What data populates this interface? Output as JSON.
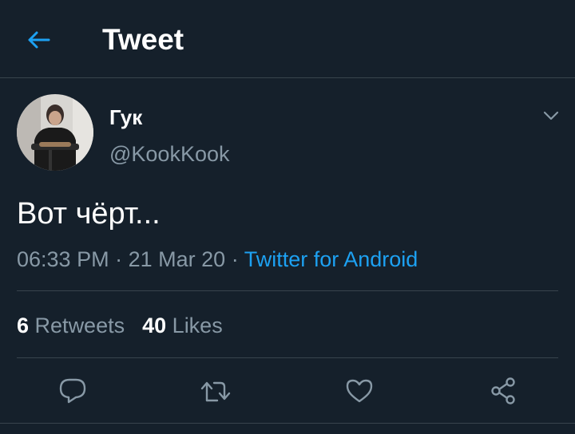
{
  "header": {
    "title": "Tweet",
    "back_icon": "arrow-left-icon"
  },
  "colors": {
    "background": "#15202b",
    "accent": "#1da1f2",
    "secondary_text": "#8899a6",
    "divider": "#38444d"
  },
  "tweet": {
    "display_name": "Гук",
    "handle": "@KookKook",
    "text": "Вот чёрт...",
    "time": "06:33 PM",
    "date": "21 Mar 20",
    "separator": "·",
    "source": "Twitter for Android",
    "menu_icon": "chevron-down-icon"
  },
  "stats": {
    "retweets_count": "6",
    "retweets_label": "Retweets",
    "likes_count": "40",
    "likes_label": "Likes"
  },
  "actions": [
    {
      "icon": "reply-icon"
    },
    {
      "icon": "retweet-icon"
    },
    {
      "icon": "heart-icon"
    },
    {
      "icon": "share-icon"
    }
  ]
}
